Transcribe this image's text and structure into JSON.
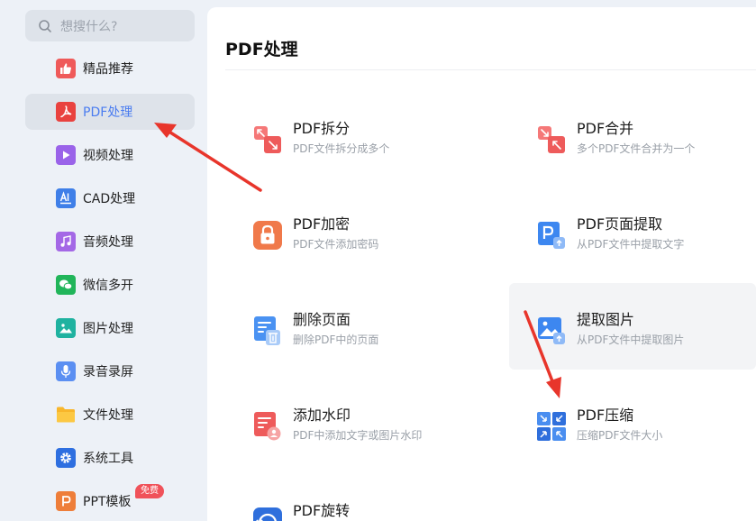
{
  "search": {
    "placeholder": "想搜什么?"
  },
  "sidebar": {
    "items": [
      {
        "label": "精品推荐",
        "icon": "thumbs-up-icon"
      },
      {
        "label": "PDF处理",
        "icon": "pdf-icon",
        "active": true
      },
      {
        "label": "视频处理",
        "icon": "video-play-icon"
      },
      {
        "label": "CAD处理",
        "icon": "cad-icon"
      },
      {
        "label": "音频处理",
        "icon": "music-note-icon"
      },
      {
        "label": "微信多开",
        "icon": "wechat-icon"
      },
      {
        "label": "图片处理",
        "icon": "image-icon"
      },
      {
        "label": "录音录屏",
        "icon": "microphone-icon"
      },
      {
        "label": "文件处理",
        "icon": "folder-icon"
      },
      {
        "label": "系统工具",
        "icon": "gear-icon"
      },
      {
        "label": "PPT模板",
        "icon": "ppt-icon",
        "badge": "免费"
      }
    ]
  },
  "main": {
    "title": "PDF处理",
    "tools": [
      {
        "name": "PDF拆分",
        "desc": "PDF文件拆分成多个",
        "icon": "pdf-split-icon"
      },
      {
        "name": "PDF合并",
        "desc": "多个PDF文件合并为一个",
        "icon": "pdf-merge-icon"
      },
      {
        "name": "PDF加密",
        "desc": "PDF文件添加密码",
        "icon": "lock-icon"
      },
      {
        "name": "PDF页面提取",
        "desc": "从PDF文件中提取文字",
        "icon": "page-extract-icon"
      },
      {
        "name": "删除页面",
        "desc": "删除PDF中的页面",
        "icon": "delete-page-icon"
      },
      {
        "name": "提取图片",
        "desc": "从PDF文件中提取图片",
        "icon": "extract-image-icon"
      },
      {
        "name": "添加水印",
        "desc": "PDF中添加文字或图片水印",
        "icon": "watermark-icon"
      },
      {
        "name": "PDF压缩",
        "desc": "压缩PDF文件大小",
        "icon": "compress-icon"
      },
      {
        "name": "PDF旋转",
        "desc": "",
        "icon": "rotate-icon"
      }
    ]
  },
  "colors": {
    "accent": "#4a7cf0",
    "annotation_arrow": "#e8352b",
    "sidebar_bg": "#edf1f7"
  }
}
